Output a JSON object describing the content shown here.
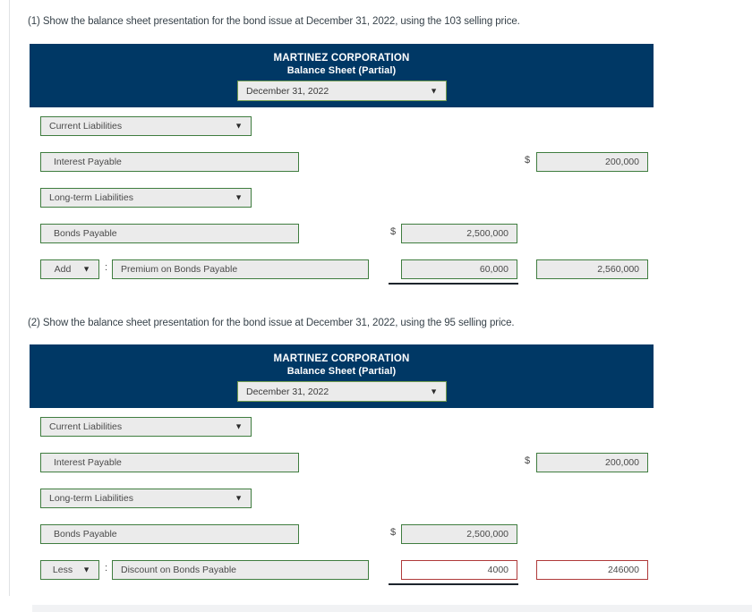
{
  "sections": [
    {
      "prompt": "(1) Show the balance sheet presentation for the bond issue at December 31, 2022, using the 103 selling price.",
      "header": {
        "company": "MARTINEZ CORPORATION",
        "statement": "Balance Sheet (Partial)",
        "date_value": "December 31, 2022",
        "date_caret": "chevron-down-icon"
      },
      "rows": {
        "current_liabilities": {
          "label": "Current Liabilities",
          "caret": "chevron-down-icon"
        },
        "interest_payable": {
          "label": "Interest Payable",
          "currency": "$",
          "amount": "200,000"
        },
        "longterm_liabilities": {
          "label": "Long-term Liabilities",
          "caret": "chevron-down-icon"
        },
        "bonds_payable": {
          "label": "Bonds Payable",
          "currency": "$",
          "amount": "2,500,000"
        },
        "adjustment": {
          "operator": "Add",
          "operator_caret": "chevron-down-icon",
          "separator": ":",
          "label": "Premium on Bonds Payable",
          "amount": "60,000",
          "total": "2,560,000",
          "amount_error": false,
          "total_error": false
        }
      }
    },
    {
      "prompt": "(2) Show the balance sheet presentation for the bond issue at December 31, 2022, using the 95 selling price.",
      "header": {
        "company": "MARTINEZ CORPORATION",
        "statement": "Balance Sheet (Partial)",
        "date_value": "December 31, 2022",
        "date_caret": "chevron-down-icon"
      },
      "rows": {
        "current_liabilities": {
          "label": "Current Liabilities",
          "caret": "chevron-down-icon"
        },
        "interest_payable": {
          "label": "Interest Payable",
          "currency": "$",
          "amount": "200,000"
        },
        "longterm_liabilities": {
          "label": "Long-term Liabilities",
          "caret": "chevron-down-icon"
        },
        "bonds_payable": {
          "label": "Bonds Payable",
          "currency": "$",
          "amount": "2,500,000"
        },
        "adjustment": {
          "operator": "Less",
          "operator_caret": "chevron-down-icon",
          "separator": ":",
          "label": "Discount on Bonds Payable",
          "amount": "4000",
          "total": "246000",
          "amount_error": true,
          "total_error": true
        }
      }
    }
  ],
  "colors": {
    "header_navy": "#003865",
    "field_border_green": "#3f7d3f",
    "field_fill": "#ebebeb",
    "error_border_red": "#b03a3a",
    "text_dark": "#37424a"
  }
}
